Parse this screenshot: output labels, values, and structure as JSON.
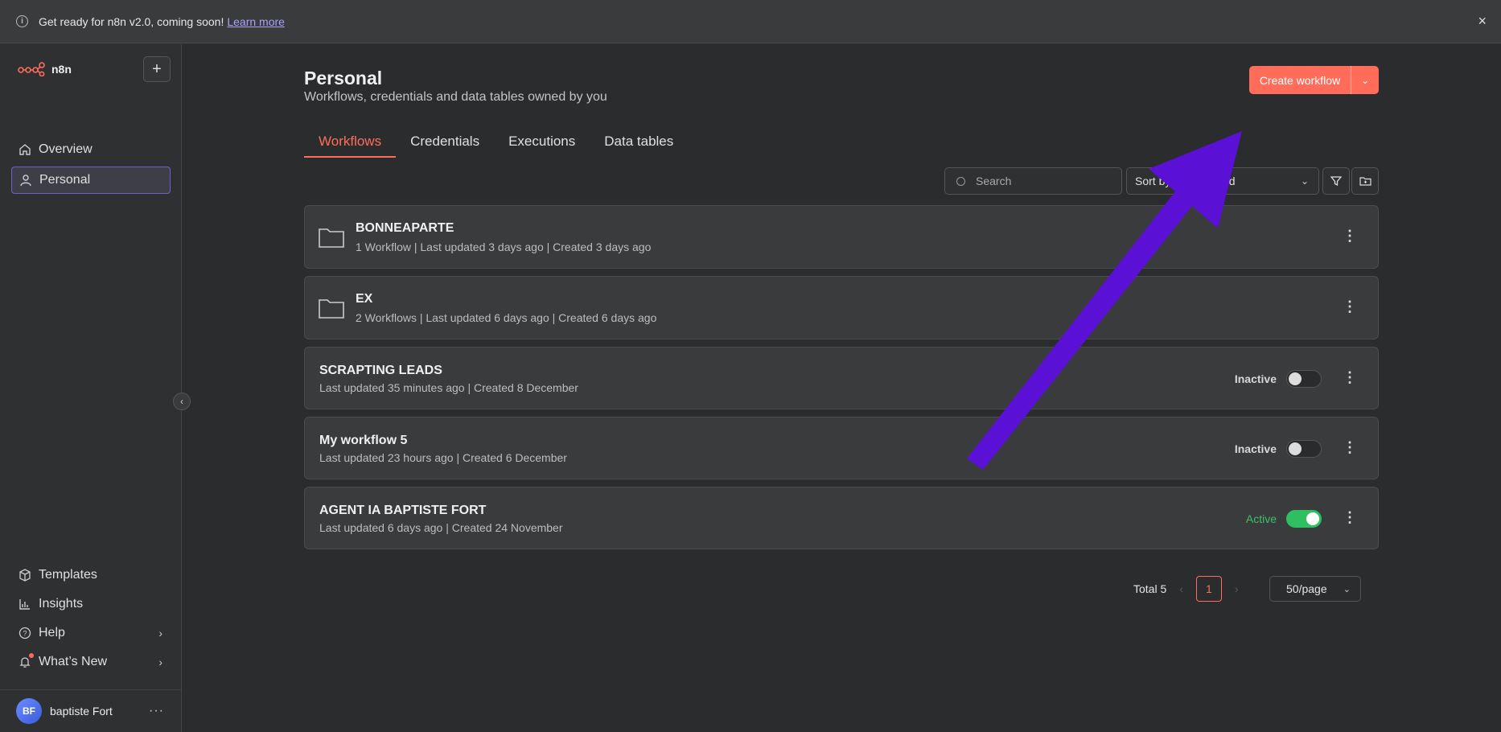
{
  "banner": {
    "text": "Get ready for n8n v2.0, coming soon!",
    "link": "Learn more",
    "close": "×"
  },
  "sidebar": {
    "brand": "n8n",
    "add": "+",
    "nav": [
      {
        "label": "Overview",
        "icon": "home-icon"
      },
      {
        "label": "Personal",
        "icon": "user-icon"
      }
    ],
    "bottom": [
      {
        "label": "Templates",
        "icon": "box-icon"
      },
      {
        "label": "Insights",
        "icon": "bar-chart-icon"
      },
      {
        "label": "Help",
        "icon": "question-icon"
      },
      {
        "label": "What’s New",
        "icon": "bell-icon"
      }
    ],
    "user": {
      "initials": "BF",
      "name": "baptiste Fort"
    }
  },
  "header": {
    "title": "Personal",
    "subtitle": "Workflows, credentials and data tables owned by you",
    "create": "Create workflow"
  },
  "tabs": [
    "Workflows",
    "Credentials",
    "Executions",
    "Data tables"
  ],
  "toolbar": {
    "search_placeholder": "Search",
    "sort": "Sort by last updated"
  },
  "folders": [
    {
      "name": "BONNEAPARTE",
      "meta": "1 Workflow | Last updated 3 days ago | Created 3 days ago"
    },
    {
      "name": "EX",
      "meta": "2 Workflows | Last updated 6 days ago | Created 6 days ago"
    }
  ],
  "workflows": [
    {
      "name": "SCRAPTING LEADS",
      "meta": "Last updated 35 minutes ago |   Created 8 December",
      "status": "Inactive",
      "active": false
    },
    {
      "name": "My workflow 5",
      "meta": "Last updated 23 hours ago |   Created 6 December",
      "status": "Inactive",
      "active": false
    },
    {
      "name": "AGENT IA BAPTISTE FORT",
      "meta": "Last updated 6 days ago |   Created 24 November",
      "status": "Active",
      "active": true
    }
  ],
  "pagination": {
    "total": "Total 5",
    "page": "1",
    "per_page": "50/page"
  },
  "colors": {
    "accent": "#ff6d5a",
    "active_green": "#2fbf60",
    "annotation_arrow": "#5b10d6"
  }
}
